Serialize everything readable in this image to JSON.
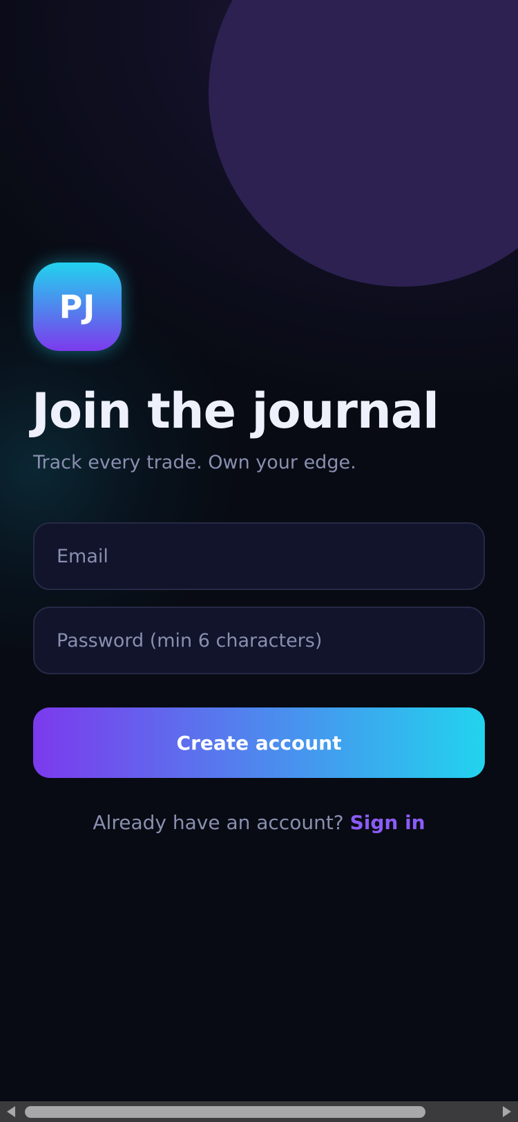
{
  "brand": {
    "logo_text": "PJ",
    "accent_purple": "#7c3aed",
    "accent_cyan": "#22d3ee"
  },
  "hero": {
    "title": "Join the journal",
    "subtitle": "Track every trade. Own your edge."
  },
  "form": {
    "email_placeholder": "Email",
    "email_value": "",
    "password_placeholder": "Password (min 6 characters)",
    "password_value": "",
    "submit_label": "Create account"
  },
  "footer": {
    "prompt": "Already have an account?",
    "signin_link": "Sign in"
  }
}
